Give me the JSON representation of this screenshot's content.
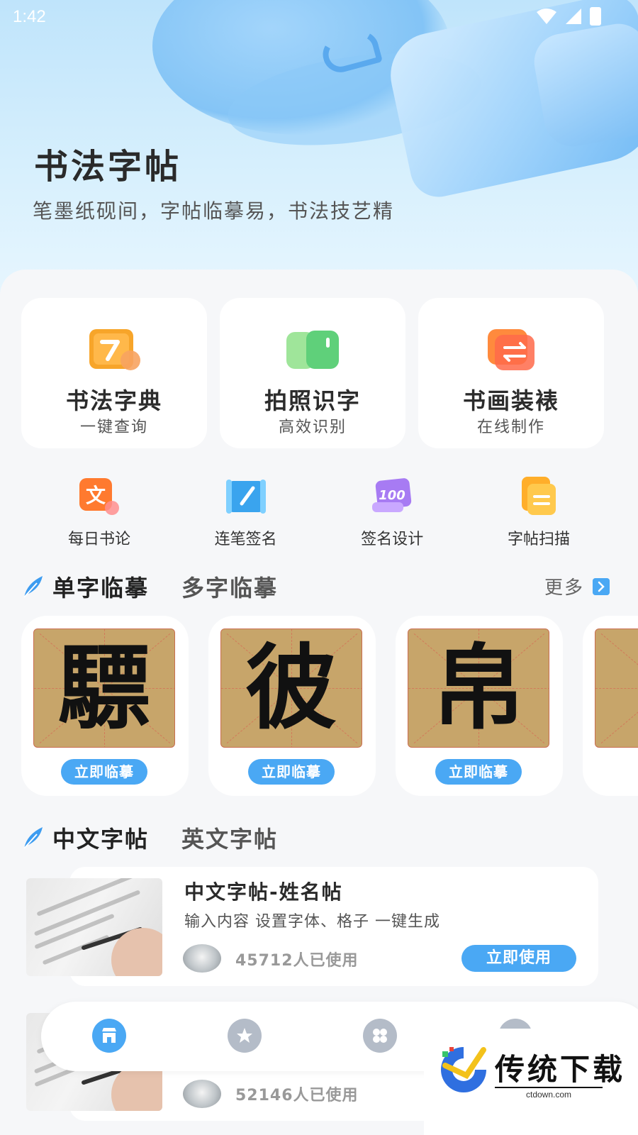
{
  "status_bar": {
    "time": "1:42"
  },
  "hero": {
    "title": "书法字帖",
    "subtitle": "笔墨纸砚间，字帖临摹易，书法技艺精"
  },
  "features": [
    {
      "title": "书法字典",
      "subtitle": "一键查询",
      "icon": "dictionary-icon"
    },
    {
      "title": "拍照识字",
      "subtitle": "高效识别",
      "icon": "camera-book-icon"
    },
    {
      "title": "书画装裱",
      "subtitle": "在线制作",
      "icon": "frame-swap-icon"
    }
  ],
  "quick_tools": [
    {
      "label": "每日书论",
      "icon": "wen-icon"
    },
    {
      "label": "连笔签名",
      "icon": "brush-icon"
    },
    {
      "label": "签名设计",
      "icon": "hundred-icon"
    },
    {
      "label": "字帖扫描",
      "icon": "doc-scan-icon"
    }
  ],
  "practice_section": {
    "tab_active": "单字临摹",
    "tab_inactive": "多字临摹",
    "more": "更多",
    "items": [
      {
        "char": "驃",
        "button": "立即临摹"
      },
      {
        "char": "彼",
        "button": "立即临摹"
      },
      {
        "char": "帛",
        "button": "立即临摹"
      }
    ]
  },
  "copybook_section": {
    "tab_active": "中文字帖",
    "tab_inactive": "英文字帖",
    "items": [
      {
        "title": "中文字帖-姓名帖",
        "desc": "输入内容 设置字体、格子 一键生成",
        "users": "45712人已使用",
        "button": "立即使用"
      },
      {
        "title": "",
        "desc": "",
        "users": "52146人已使用",
        "button": ""
      }
    ]
  },
  "bottom_nav": [
    {
      "icon": "home-store-icon",
      "active": true
    },
    {
      "icon": "star-icon",
      "active": false
    },
    {
      "icon": "apps-grid-icon",
      "active": false
    },
    {
      "icon": "profile-icon",
      "active": false
    }
  ],
  "watermark": {
    "text": "传统下载",
    "sub": "ctdown.com"
  },
  "colors": {
    "accent": "#4aa8f4",
    "hero_bg": "#bfe4fb",
    "paper": "#c7a56a"
  }
}
